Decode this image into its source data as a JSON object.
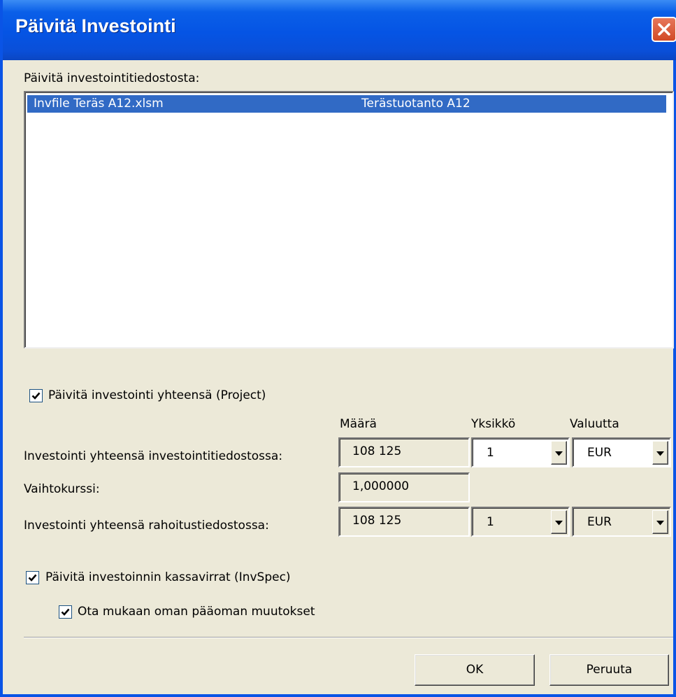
{
  "window": {
    "title": "Päivitä Investointi"
  },
  "source": {
    "label": "Päivitä investointitiedostosta:",
    "items": [
      {
        "file": "Invfile Teräs A12.xlsm",
        "project": "Terästuotanto A12",
        "selected": true
      }
    ]
  },
  "project_update": {
    "label": "Päivitä investointi yhteensä (Project)",
    "checked": true
  },
  "columns": {
    "amount": "Määrä",
    "unit": "Yksikkö",
    "currency": "Valuutta"
  },
  "rows": {
    "investment_file": {
      "label": "Investointi yhteensä investointitiedostossa:",
      "amount": "108 125",
      "unit": "1",
      "currency": "EUR"
    },
    "exchange_rate": {
      "label": "Vaihtokurssi:",
      "value": "1,000000"
    },
    "financing_file": {
      "label": "Investointi yhteensä rahoitustiedostossa:",
      "amount": "108 125",
      "unit": "1",
      "currency": "EUR"
    }
  },
  "cashflows_update": {
    "label": "Päivitä investoinnin kassavirrat (InvSpec)",
    "checked": true
  },
  "equity_changes": {
    "label": "Ota mukaan oman pääoman muutokset",
    "checked": true
  },
  "buttons": {
    "ok": "OK",
    "cancel": "Peruuta"
  },
  "colors": {
    "titlebar": "#0554e4",
    "selection": "#316ac5",
    "face": "#ece9d8",
    "close": "#d24a26"
  },
  "icons": {
    "close": "close-icon",
    "dropdown": "chevron-down-icon",
    "check": "check-icon"
  }
}
